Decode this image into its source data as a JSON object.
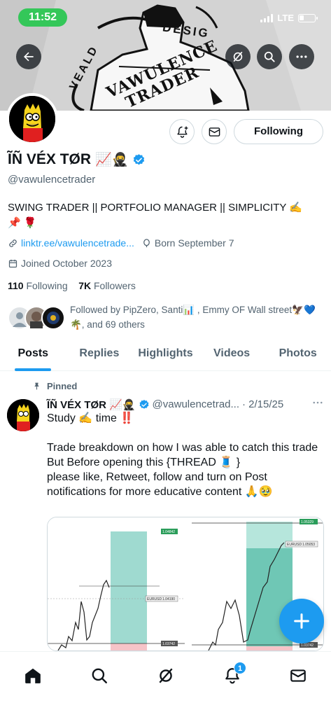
{
  "status_bar": {
    "time": "11:52",
    "network": "LTE"
  },
  "profile": {
    "display_name": "ĨÑ VÉX TØR",
    "name_emoji": "📈🥷",
    "handle": "@vawulencetrader",
    "bio_line1": "SWING TRADER || PORTFOLIO MANAGER || SIMPLICITY ✍️",
    "bio_line2": "📌 🌹",
    "link": "linktr.ee/vawulencetrade...",
    "born": "Born September 7",
    "joined": "Joined October 2023",
    "following_count": "110",
    "following_label": "Following",
    "followers_count": "7K",
    "followers_label": "Followers",
    "followed_by": "Followed by PipZero, Santi📊 , Emmy OF Wall street🦅💙🌴, and 69 others",
    "following_button": "Following"
  },
  "banner_text": {
    "top": "DESIG",
    "left": "VEALD",
    "main1": "VAWULENCE",
    "main2": "TRADER"
  },
  "tabs": [
    "Posts",
    "Replies",
    "Highlights",
    "Videos",
    "Photos"
  ],
  "tweet": {
    "pinned_label": "Pinned",
    "author": "ĨÑ VÉX TØR 📈🥷",
    "handle": "@vawulencetrad...",
    "date": "· 2/15/25",
    "text": "Study ✍️ time ‼️\n\nTrade breakdown on how I was able to catch this trade\nBut Before opening this {THREAD 🧵 }\nplease like, Retweet, follow and turn on Post notifications for more educative content 🙏🥹",
    "chart_left": {
      "target": "1.04842",
      "pair": "EURUSD",
      "price": "1.04190",
      "stop": "1.03742"
    },
    "chart_right": {
      "target": "1.05329",
      "pair": "EURUSD",
      "price": "1.05053",
      "stop": "1.03742"
    }
  },
  "nav": {
    "notifications_badge": "1"
  },
  "colors": {
    "accent": "#1d9bf0",
    "text": "#0f1419",
    "muted": "#536471",
    "status_green": "#34c759"
  }
}
